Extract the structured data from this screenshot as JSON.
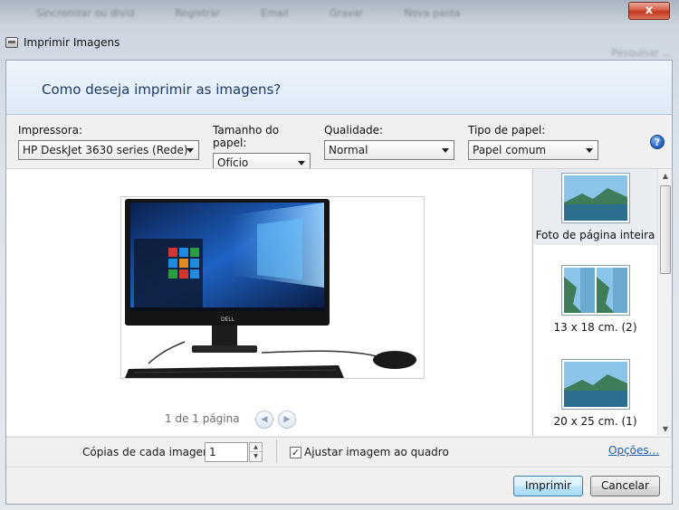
{
  "background": {
    "menu": [
      "Sincronizar ou divid",
      "Registrar",
      "Email",
      "Gravar",
      "Nova pasta"
    ],
    "right_text": "Pesquisar ..."
  },
  "window": {
    "title": "Imprimir Imagens",
    "close_label": "x",
    "header": "Como deseja imprimir as imagens?"
  },
  "options": {
    "printer": {
      "label": "Impressora:",
      "value": "HP DeskJet 3630 series (Rede)"
    },
    "paper_size": {
      "label": "Tamanho do papel:",
      "value": "Ofício"
    },
    "quality": {
      "label": "Qualidade:",
      "value": "Normal"
    },
    "paper_type": {
      "label": "Tipo de papel:",
      "value": "Papel comum"
    },
    "help": "?"
  },
  "preview": {
    "page_info": "1 de 1 página",
    "prev": "◀",
    "next": "▶",
    "brand": "DELL"
  },
  "layouts": [
    {
      "label": "Foto de página inteira",
      "selected": true
    },
    {
      "label": "13 x 18 cm. (2)",
      "selected": false
    },
    {
      "label": "20 x 25 cm. (1)",
      "selected": false
    }
  ],
  "scroll": {
    "up": "▲",
    "down": "▼"
  },
  "copies": {
    "label": "Cópias de cada imagem:",
    "value": "1",
    "up": "▲",
    "down": "▼"
  },
  "fit": {
    "checked_glyph": "✓",
    "label": "Ajustar imagem ao quadro"
  },
  "options_link": "Opções...",
  "buttons": {
    "print": "Imprimir",
    "cancel": "Cancelar"
  }
}
